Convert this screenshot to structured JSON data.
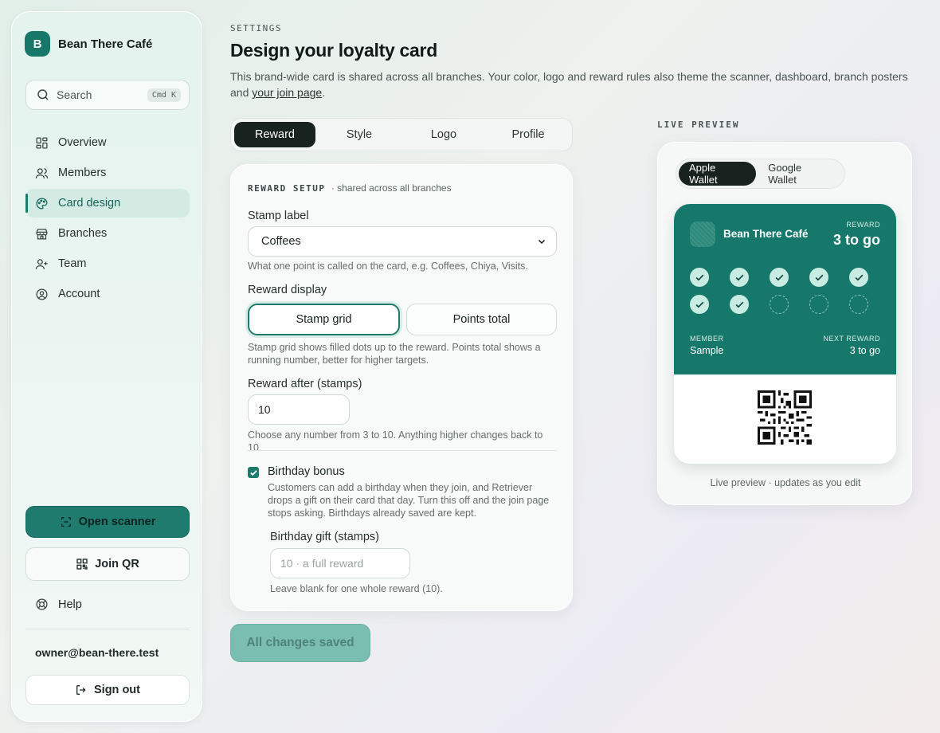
{
  "brand": {
    "initial": "B",
    "name": "Bean There Café",
    "color": "#177768"
  },
  "search": {
    "placeholder": "Search",
    "shortcut": "Cmd K"
  },
  "sidebar": {
    "items": [
      {
        "label": "Overview",
        "icon": "grid-icon"
      },
      {
        "label": "Members",
        "icon": "users-icon"
      },
      {
        "label": "Card design",
        "icon": "palette-icon",
        "active": true
      },
      {
        "label": "Branches",
        "icon": "store-icon"
      },
      {
        "label": "Team",
        "icon": "user-plus-icon"
      },
      {
        "label": "Account",
        "icon": "user-circle-icon"
      }
    ],
    "open_scanner": "Open scanner",
    "join_qr": "Join QR",
    "help": "Help",
    "owner_email": "owner@bean-there.test",
    "sign_out": "Sign out"
  },
  "header": {
    "eyebrow": "SETTINGS",
    "title": "Design your loyalty card",
    "description": "This brand-wide card is shared across all branches. Your color, logo and reward rules also theme the scanner, dashboard, branch posters and ",
    "description_link": "your join page",
    "description_end": "."
  },
  "tabs": [
    {
      "label": "Reward",
      "active": true
    },
    {
      "label": "Style"
    },
    {
      "label": "Logo"
    },
    {
      "label": "Profile"
    }
  ],
  "reward_setup": {
    "section_title": "REWARD SETUP",
    "section_note": "· shared across all branches",
    "stamp_label": {
      "label": "Stamp label",
      "value": "Coffees",
      "hint": "What one point is called on the card, e.g. Coffees, Chiya, Visits."
    },
    "reward_display": {
      "label": "Reward display",
      "options": [
        "Stamp grid",
        "Points total"
      ],
      "selected": "Stamp grid",
      "hint": "Stamp grid shows filled dots up to the reward. Points total shows a running number, better for higher targets."
    },
    "reward_after": {
      "label": "Reward after (stamps)",
      "value": "10",
      "hint": "Choose any number from 3 to 10. Anything higher changes back to 10."
    },
    "birthday": {
      "label": "Birthday bonus",
      "checked": true,
      "description": "Customers can add a birthday when they join, and Retriever drops a gift on their card that day. Turn this off and the join page stops asking. Birthdays already saved are kept.",
      "gift_label": "Birthday gift (stamps)",
      "gift_placeholder": "10 · a full reward",
      "gift_hint": "Leave blank for one whole reward (10)."
    }
  },
  "save_button": "All changes saved",
  "preview": {
    "label": "LIVE PREVIEW",
    "wallet_options": [
      "Apple Wallet",
      "Google Wallet"
    ],
    "wallet_selected": "Apple Wallet",
    "card": {
      "name": "Bean There Café",
      "reward_label": "REWARD",
      "reward_value": "3 to go",
      "stamps_total": 10,
      "stamps_filled": 7,
      "member_label": "MEMBER",
      "member_value": "Sample",
      "next_label": "NEXT REWARD",
      "next_value": "3 to go",
      "card_color": "#16786a"
    },
    "caption": "Live preview · updates as you edit"
  }
}
